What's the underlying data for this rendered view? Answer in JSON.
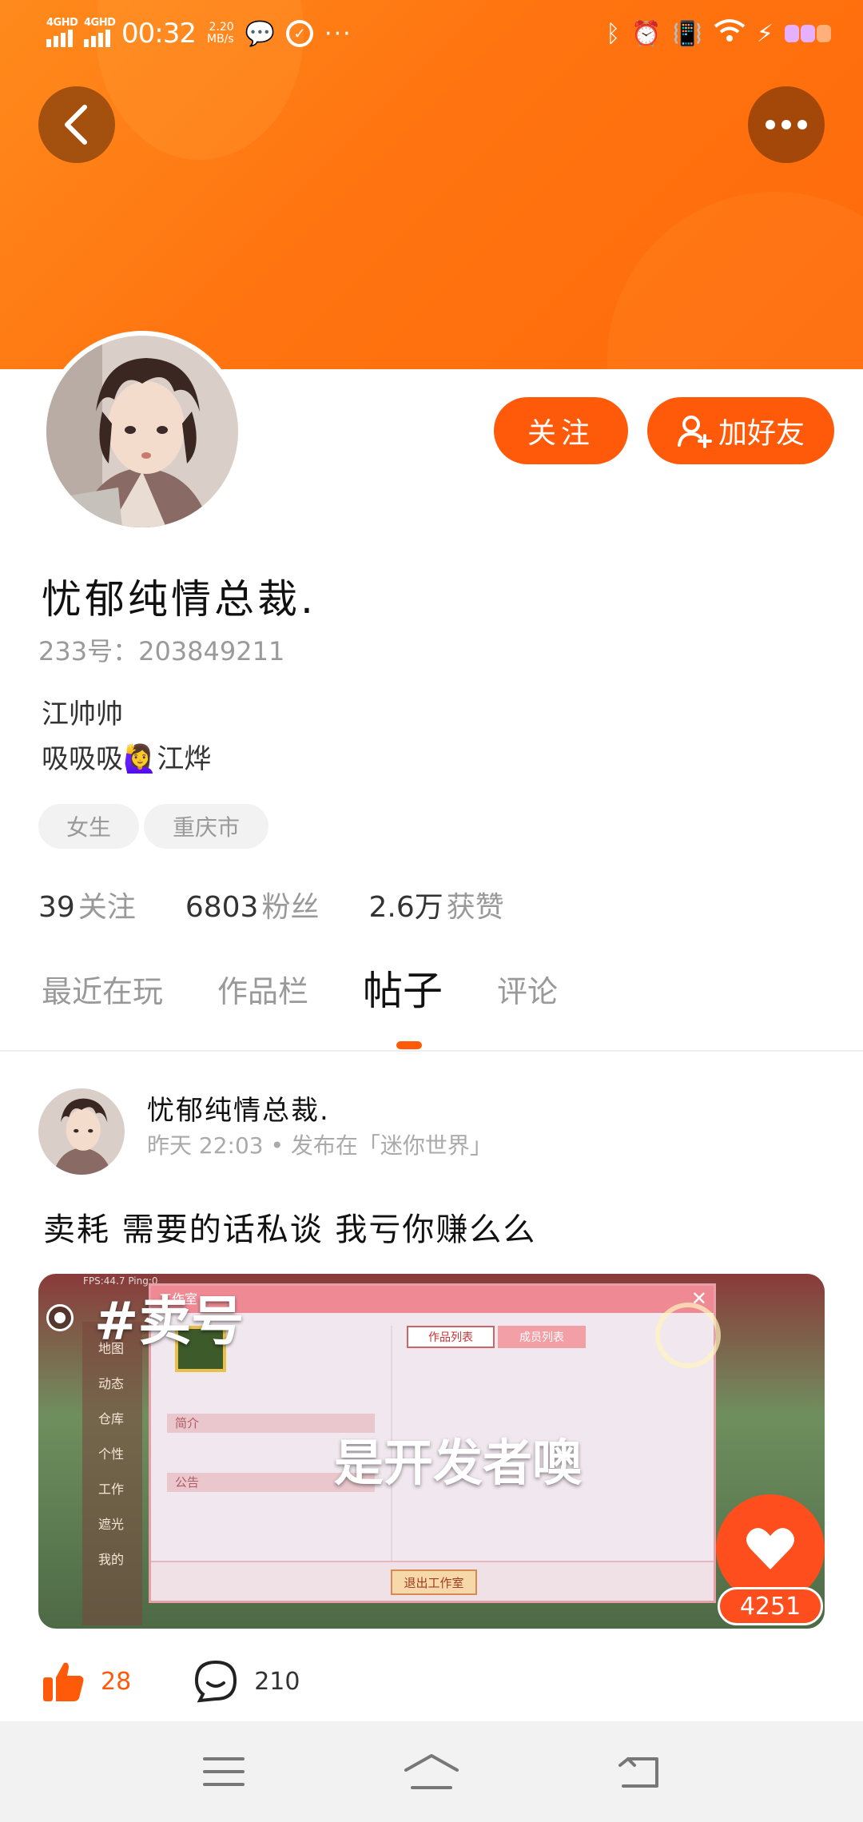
{
  "status_bar": {
    "signal1": "4GHD",
    "signal2": "4GHD",
    "time": "00:32",
    "speed_value": "2.20",
    "speed_unit": "MB/s",
    "overflow": "···"
  },
  "profile": {
    "nickname": "忧郁纯情总裁.",
    "uid_label": "233号：",
    "uid_value": "203849211",
    "bio_line1": "江帅帅",
    "bio_line2": "吸吸吸🙋‍♀️江烨",
    "tags": [
      "女生",
      "重庆市"
    ],
    "follow_label": "关注",
    "add_friend_label": "加好友"
  },
  "stats": {
    "following_count": "39",
    "following_label": "关注",
    "fans_count": "6803",
    "fans_label": "粉丝",
    "likes_count": "2.6万",
    "likes_label": "获赞"
  },
  "tabs": {
    "items": [
      "最近在玩",
      "作品栏",
      "帖子",
      "评论"
    ],
    "active_index": 2
  },
  "post": {
    "author": "忧郁纯情总裁.",
    "time": "昨天 22:03",
    "separator": "•",
    "published_in": "发布在「迷你世界」",
    "text": "卖耗 需要的话私谈 我亏你赚么么",
    "image": {
      "hashtag": "#卖号",
      "caption": "是开发者噢",
      "fps_text": "FPS:44.7 Ping:0",
      "window_title": "工作室",
      "tab_works": "作品列表",
      "tab_members": "成员列表",
      "row_intro": "简介",
      "row_notice": "公告",
      "exit_button": "退出工作室",
      "side_items": [
        "地图",
        "动态",
        "仓库",
        "个性",
        "工作",
        "遮光",
        "我的"
      ]
    },
    "like_badge_count": "4251",
    "likes": "28",
    "comments": "210"
  },
  "colors": {
    "accent": "#ff5a0a",
    "banner_start": "#ff8a1c",
    "banner_end": "#ff6a0a",
    "muted_text": "#999999"
  },
  "icons": {
    "back": "chevron-left-icon",
    "more": "more-dots-icon",
    "add_friend": "add-user-icon",
    "like": "thumbs-up-icon",
    "comment": "comment-bubble-icon",
    "heart": "heart-icon",
    "nav_menu": "menu-icon",
    "nav_home": "home-icon",
    "nav_back": "back-icon"
  }
}
